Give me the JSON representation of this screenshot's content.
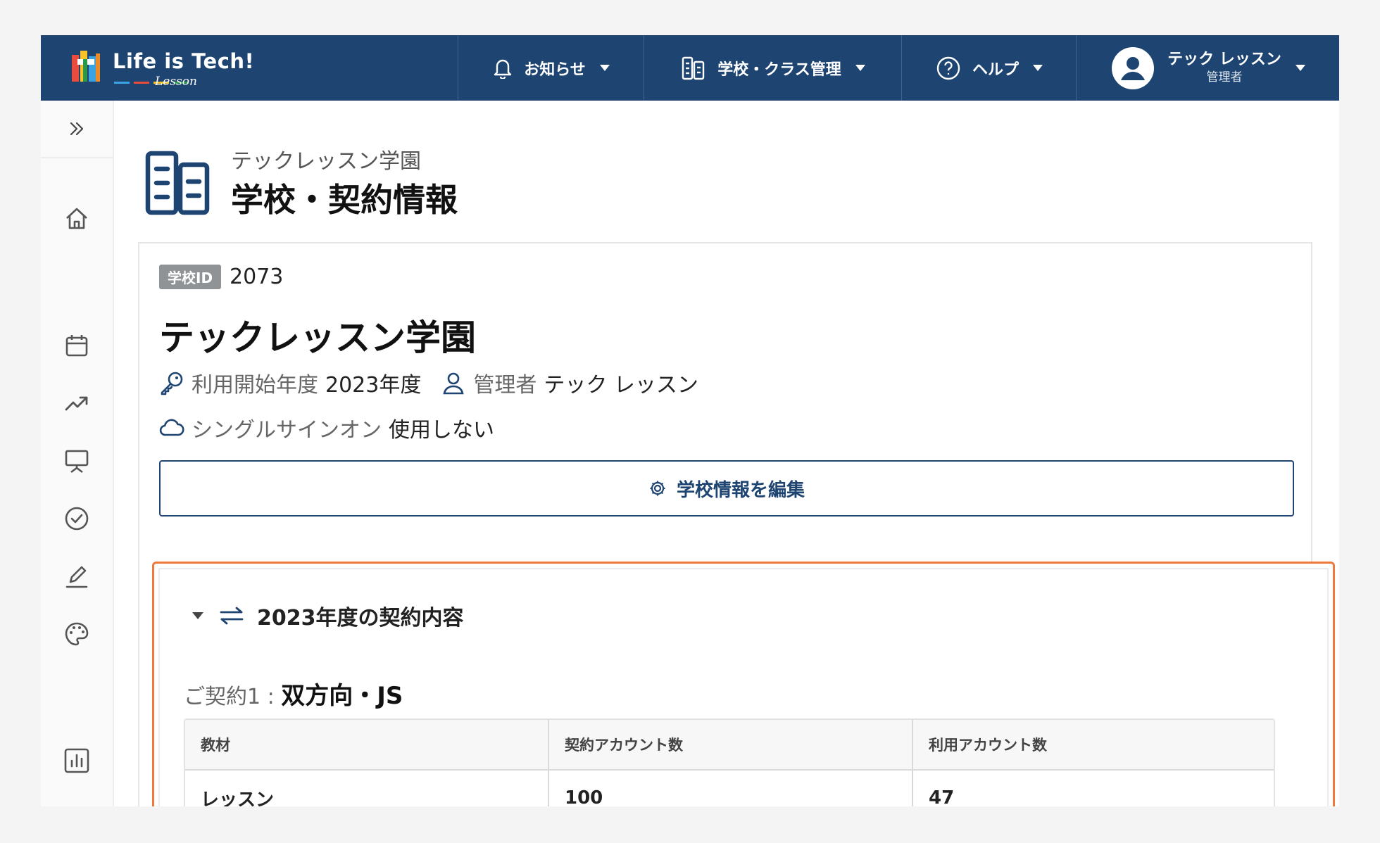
{
  "header": {
    "logo_text": "Life is Tech!",
    "logo_sub": "Lesson",
    "nav": {
      "news": "お知らせ",
      "school_class": "学校・クラス管理",
      "help": "ヘルプ"
    },
    "user": {
      "name": "テック レッスン",
      "role": "管理者"
    }
  },
  "sidebar": {
    "icons": [
      "expand-icon",
      "home-icon",
      "calendar-icon",
      "trending-up-icon",
      "presentation-icon",
      "check-circle-icon",
      "pencil-icon",
      "palette-icon",
      "bar-chart-icon"
    ]
  },
  "page": {
    "school_sub": "テックレッスン学園",
    "title": "学校・契約情報"
  },
  "card": {
    "school_id_label": "学校ID",
    "school_id": "2073",
    "school_name": "テックレッスン学園",
    "start_year_label": "利用開始年度",
    "start_year": "2023年度",
    "admin_label": "管理者",
    "admin": "テック レッスン",
    "sso_label": "シングルサインオン",
    "sso": "使用しない",
    "edit_button": "学校情報を編集"
  },
  "contract": {
    "heading": "2023年度の契約内容",
    "label": "ご契約1 : ",
    "name": "双方向・JS",
    "table": {
      "headers": [
        "教材",
        "契約アカウント数",
        "利用アカウント数"
      ],
      "rows": [
        [
          "レッスン",
          "100",
          "47"
        ]
      ]
    }
  },
  "colors": {
    "header_bg": "#1e4472",
    "highlight": "#ed7a3c"
  }
}
